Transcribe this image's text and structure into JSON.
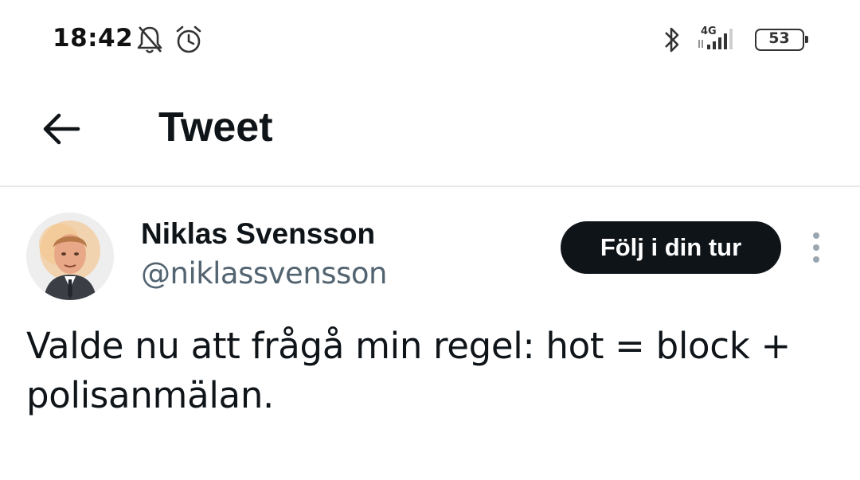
{
  "status_bar": {
    "time": "18:42",
    "network": "4G",
    "battery": "53",
    "icons": [
      "bell-off-icon",
      "alarm-icon",
      "bluetooth-icon",
      "signal-icon",
      "battery-icon"
    ]
  },
  "header": {
    "title": "Tweet",
    "back_icon": "arrow-left-icon"
  },
  "author": {
    "name": "Niklas Svensson",
    "handle": "@niklassvensson"
  },
  "follow_button": {
    "label": "Följ i din tur"
  },
  "more_icon": "more-vertical-icon",
  "tweet": {
    "text": "Valde nu att frågå min regel: hot = block + polisanmälan."
  },
  "colors": {
    "text": "#0f1419",
    "secondary_text": "#536471",
    "button_bg": "#0f1419",
    "divider": "#e6eaed"
  }
}
